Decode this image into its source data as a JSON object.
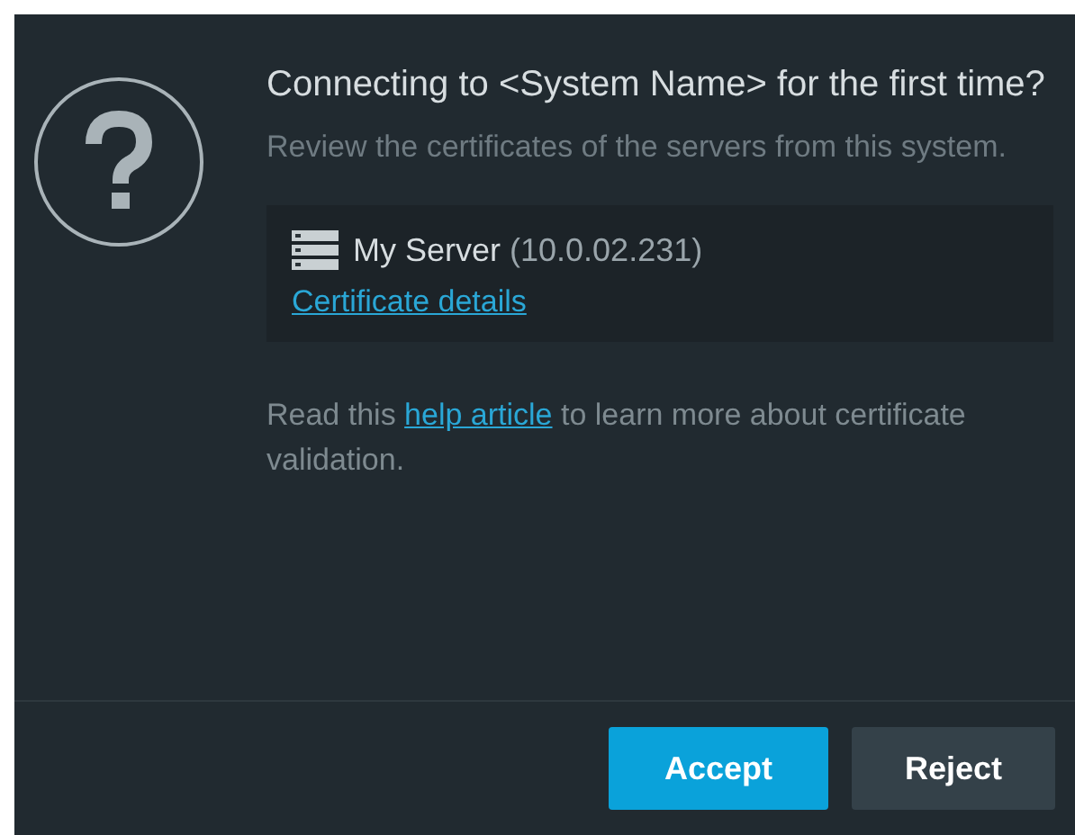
{
  "dialog": {
    "title": "Connecting to <System Name> for the first time?",
    "description": "Review the certificates of the servers from this system.",
    "server": {
      "name": "My Server",
      "address": "(10.0.02.231)",
      "link": "Certificate details"
    },
    "help": {
      "before": "Read this ",
      "link": "help article",
      "after": " to learn more about certificate validation."
    },
    "buttons": [
      {
        "label": "Accept",
        "kind": "primary"
      },
      {
        "label": "Reject",
        "kind": "secondary"
      }
    ]
  }
}
